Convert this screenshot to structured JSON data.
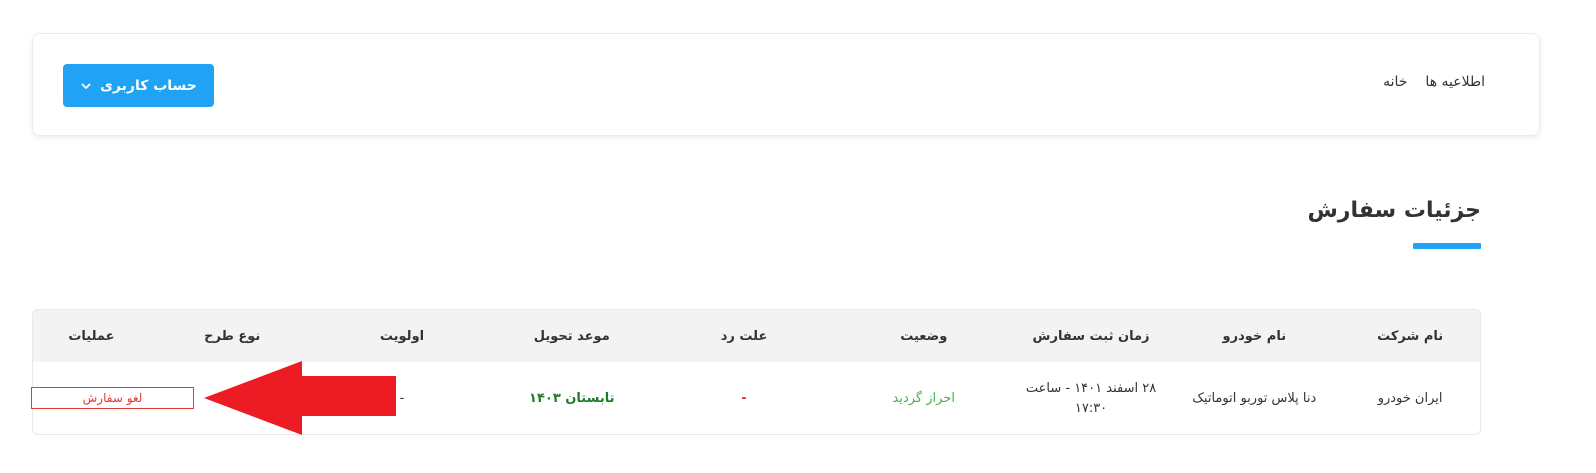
{
  "nav": {
    "home": "خانه",
    "announcements": "اطلاعیه ها",
    "account_button": "حساب کاربری"
  },
  "page_title": "جزئیات سفارش",
  "colors": {
    "accent": "#21a3f5",
    "danger": "#e53935",
    "success": "#4caf50",
    "delivery": "#1b7f2a",
    "arrow": "#ed1c24"
  },
  "table": {
    "headers": [
      "نام شرکت",
      "نام خودرو",
      "زمان ثبت سفارش",
      "وضعیت",
      "علت رد",
      "موعد تحویل",
      "اولویت",
      "نوع طرح",
      "عملیات"
    ],
    "row": {
      "company": "ایران خودرو",
      "car": "دنا پلاس توربو اتوماتیک",
      "datetime": "۲۸ اسفند ۱۴۰۱ - ساعت ۱۷:۳۰",
      "status": "احراز گردید",
      "reject_reason": "-",
      "delivery": "تابستان ۱۴۰۳",
      "priority": "-",
      "plan_type": "",
      "action": "لغو سفارش"
    }
  },
  "icons": {
    "account_chevron": "chevron-down-icon",
    "annotation_arrow": "red-arrow-left-icon"
  }
}
